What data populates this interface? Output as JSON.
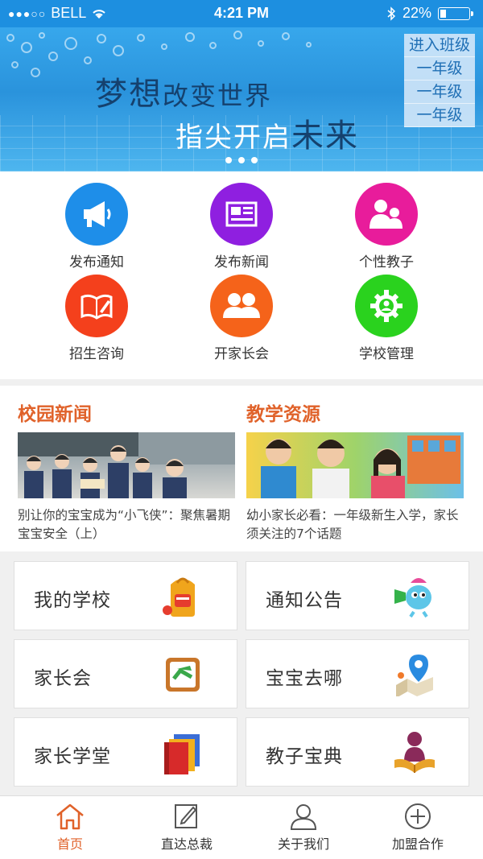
{
  "status_bar": {
    "signal_dots": "●●●○○",
    "carrier": "BELL",
    "time": "4:21 PM",
    "battery_percent": "22%",
    "battery_level": 0.22
  },
  "banner": {
    "slogan_line1_a": "梦想",
    "slogan_line1_b": "改变世界",
    "slogan_line2_a": "指尖开启",
    "slogan_line2_b": "未来",
    "class_menu": [
      "进入班级",
      "一年级",
      "一年级",
      "一年级"
    ],
    "pager_dots": 3
  },
  "quick_actions": [
    {
      "label": "发布通知",
      "color": "#1e8ee9",
      "icon": "megaphone-icon"
    },
    {
      "label": "发布新闻",
      "color": "#8f1fe0",
      "icon": "newspaper-icon"
    },
    {
      "label": "个性教子",
      "color": "#e81c9b",
      "icon": "parent-child-icon"
    },
    {
      "label": "招生咨询",
      "color": "#f4401c",
      "icon": "book-pencil-icon"
    },
    {
      "label": "开家长会",
      "color": "#f5631a",
      "icon": "people-icon"
    },
    {
      "label": "学校管理",
      "color": "#2ad21e",
      "icon": "gear-user-icon"
    }
  ],
  "news": {
    "campus": {
      "title": "校园新闻",
      "text": "别让你的宝宝成为“小飞侠”：聚焦暑期宝宝安全（上）"
    },
    "resources": {
      "title": "教学资源",
      "text": "幼小家长必看：一年级新生入学，家长须关注的7个话题"
    }
  },
  "cards": [
    {
      "label": "我的学校",
      "icon": "backpack-icon"
    },
    {
      "label": "通知公告",
      "icon": "mascot-megaphone-icon"
    },
    {
      "label": "家长会",
      "icon": "notepad-icon"
    },
    {
      "label": "宝宝去哪",
      "icon": "map-pin-icon"
    },
    {
      "label": "家长学堂",
      "icon": "books-icon"
    },
    {
      "label": "教子宝典",
      "icon": "reader-icon"
    }
  ],
  "tabbar": [
    {
      "label": "首页",
      "icon": "home-icon",
      "active": true
    },
    {
      "label": "直达总裁",
      "icon": "edit-icon",
      "active": false
    },
    {
      "label": "关于我们",
      "icon": "user-icon",
      "active": false
    },
    {
      "label": "加盟合作",
      "icon": "plus-circle-icon",
      "active": false
    }
  ],
  "colors": {
    "accent": "#e0622a",
    "status_bar": "#1d8fe0"
  }
}
